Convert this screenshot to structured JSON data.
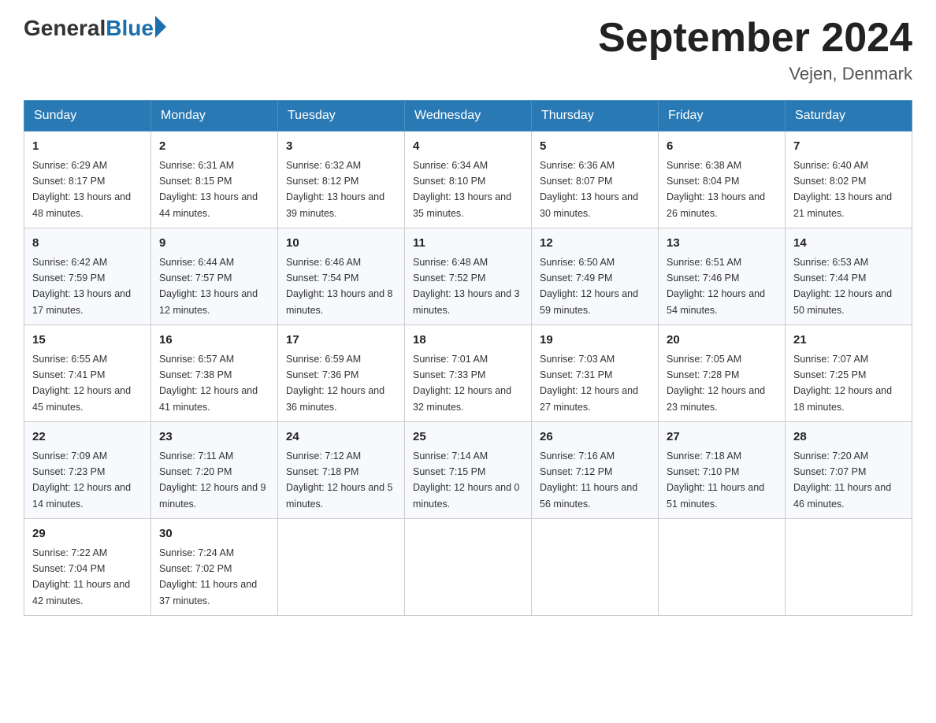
{
  "header": {
    "logo": {
      "general": "General",
      "blue": "Blue"
    },
    "title": "September 2024",
    "location": "Vejen, Denmark"
  },
  "days_of_week": [
    "Sunday",
    "Monday",
    "Tuesday",
    "Wednesday",
    "Thursday",
    "Friday",
    "Saturday"
  ],
  "weeks": [
    [
      {
        "day": "1",
        "sunrise": "6:29 AM",
        "sunset": "8:17 PM",
        "daylight": "13 hours and 48 minutes."
      },
      {
        "day": "2",
        "sunrise": "6:31 AM",
        "sunset": "8:15 PM",
        "daylight": "13 hours and 44 minutes."
      },
      {
        "day": "3",
        "sunrise": "6:32 AM",
        "sunset": "8:12 PM",
        "daylight": "13 hours and 39 minutes."
      },
      {
        "day": "4",
        "sunrise": "6:34 AM",
        "sunset": "8:10 PM",
        "daylight": "13 hours and 35 minutes."
      },
      {
        "day": "5",
        "sunrise": "6:36 AM",
        "sunset": "8:07 PM",
        "daylight": "13 hours and 30 minutes."
      },
      {
        "day": "6",
        "sunrise": "6:38 AM",
        "sunset": "8:04 PM",
        "daylight": "13 hours and 26 minutes."
      },
      {
        "day": "7",
        "sunrise": "6:40 AM",
        "sunset": "8:02 PM",
        "daylight": "13 hours and 21 minutes."
      }
    ],
    [
      {
        "day": "8",
        "sunrise": "6:42 AM",
        "sunset": "7:59 PM",
        "daylight": "13 hours and 17 minutes."
      },
      {
        "day": "9",
        "sunrise": "6:44 AM",
        "sunset": "7:57 PM",
        "daylight": "13 hours and 12 minutes."
      },
      {
        "day": "10",
        "sunrise": "6:46 AM",
        "sunset": "7:54 PM",
        "daylight": "13 hours and 8 minutes."
      },
      {
        "day": "11",
        "sunrise": "6:48 AM",
        "sunset": "7:52 PM",
        "daylight": "13 hours and 3 minutes."
      },
      {
        "day": "12",
        "sunrise": "6:50 AM",
        "sunset": "7:49 PM",
        "daylight": "12 hours and 59 minutes."
      },
      {
        "day": "13",
        "sunrise": "6:51 AM",
        "sunset": "7:46 PM",
        "daylight": "12 hours and 54 minutes."
      },
      {
        "day": "14",
        "sunrise": "6:53 AM",
        "sunset": "7:44 PM",
        "daylight": "12 hours and 50 minutes."
      }
    ],
    [
      {
        "day": "15",
        "sunrise": "6:55 AM",
        "sunset": "7:41 PM",
        "daylight": "12 hours and 45 minutes."
      },
      {
        "day": "16",
        "sunrise": "6:57 AM",
        "sunset": "7:38 PM",
        "daylight": "12 hours and 41 minutes."
      },
      {
        "day": "17",
        "sunrise": "6:59 AM",
        "sunset": "7:36 PM",
        "daylight": "12 hours and 36 minutes."
      },
      {
        "day": "18",
        "sunrise": "7:01 AM",
        "sunset": "7:33 PM",
        "daylight": "12 hours and 32 minutes."
      },
      {
        "day": "19",
        "sunrise": "7:03 AM",
        "sunset": "7:31 PM",
        "daylight": "12 hours and 27 minutes."
      },
      {
        "day": "20",
        "sunrise": "7:05 AM",
        "sunset": "7:28 PM",
        "daylight": "12 hours and 23 minutes."
      },
      {
        "day": "21",
        "sunrise": "7:07 AM",
        "sunset": "7:25 PM",
        "daylight": "12 hours and 18 minutes."
      }
    ],
    [
      {
        "day": "22",
        "sunrise": "7:09 AM",
        "sunset": "7:23 PM",
        "daylight": "12 hours and 14 minutes."
      },
      {
        "day": "23",
        "sunrise": "7:11 AM",
        "sunset": "7:20 PM",
        "daylight": "12 hours and 9 minutes."
      },
      {
        "day": "24",
        "sunrise": "7:12 AM",
        "sunset": "7:18 PM",
        "daylight": "12 hours and 5 minutes."
      },
      {
        "day": "25",
        "sunrise": "7:14 AM",
        "sunset": "7:15 PM",
        "daylight": "12 hours and 0 minutes."
      },
      {
        "day": "26",
        "sunrise": "7:16 AM",
        "sunset": "7:12 PM",
        "daylight": "11 hours and 56 minutes."
      },
      {
        "day": "27",
        "sunrise": "7:18 AM",
        "sunset": "7:10 PM",
        "daylight": "11 hours and 51 minutes."
      },
      {
        "day": "28",
        "sunrise": "7:20 AM",
        "sunset": "7:07 PM",
        "daylight": "11 hours and 46 minutes."
      }
    ],
    [
      {
        "day": "29",
        "sunrise": "7:22 AM",
        "sunset": "7:04 PM",
        "daylight": "11 hours and 42 minutes."
      },
      {
        "day": "30",
        "sunrise": "7:24 AM",
        "sunset": "7:02 PM",
        "daylight": "11 hours and 37 minutes."
      },
      null,
      null,
      null,
      null,
      null
    ]
  ]
}
